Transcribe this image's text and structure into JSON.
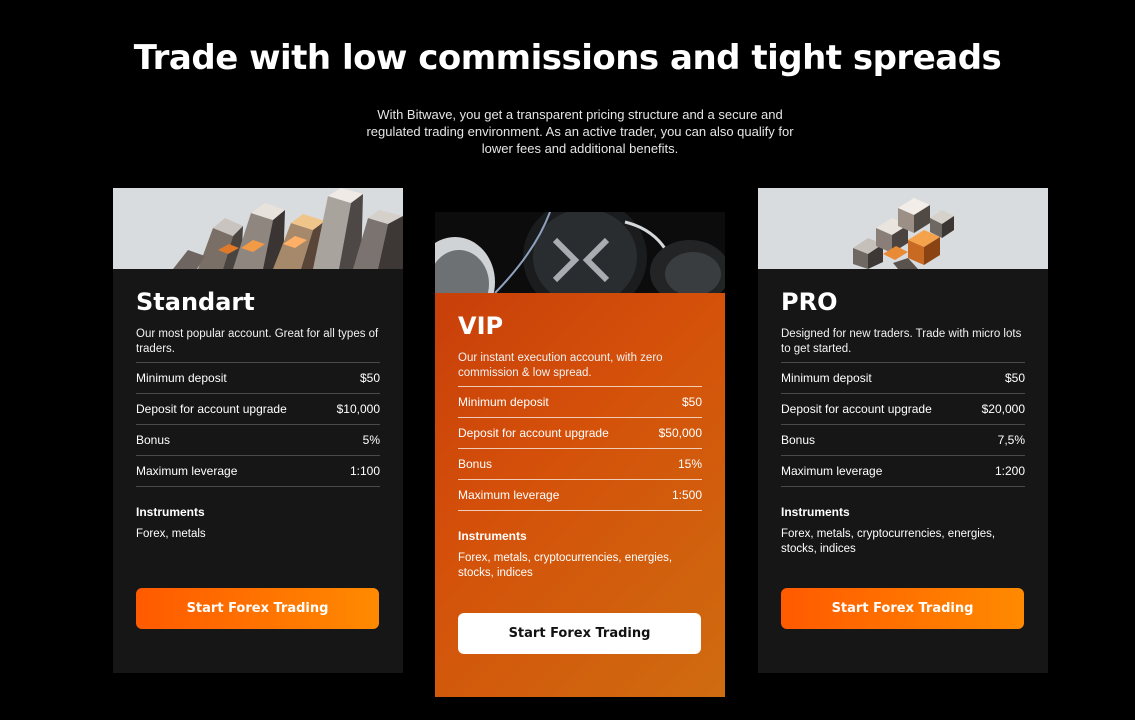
{
  "hero": {
    "headline": "Trade with low commissions and tight spreads",
    "subtitle": "With Bitwave, you get a transparent pricing structure and a secure and regulated trading environment. As an active trader, you can also qualify for lower fees and additional benefits."
  },
  "colors": {
    "background": "#000000",
    "card": "#161616",
    "accent_orange": "#ff6a00",
    "vip_gradient_start": "#c43a0a",
    "vip_gradient_end": "#cf6c10"
  },
  "plans": [
    {
      "name": "Standart",
      "description": "Our most popular account. Great for all types of traders.",
      "specs": [
        {
          "label": "Minimum deposit",
          "value": "$50"
        },
        {
          "label": "Deposit for account upgrade",
          "value": "$10,000"
        },
        {
          "label": "Bonus",
          "value": "5%"
        },
        {
          "label": "Maximum leverage",
          "value": "1:100"
        }
      ],
      "instruments_label": "Instruments",
      "instruments": "Forex, metals",
      "cta": "Start Forex Trading"
    },
    {
      "name": "VIP",
      "description": "Our instant execution account, with zero commission & low spread.",
      "specs": [
        {
          "label": "Minimum deposit",
          "value": "$50"
        },
        {
          "label": "Deposit for account upgrade",
          "value": "$50,000"
        },
        {
          "label": "Bonus",
          "value": "15%"
        },
        {
          "label": "Maximum leverage",
          "value": "1:500"
        }
      ],
      "instruments_label": "Instruments",
      "instruments": "Forex, metals, cryptocurrencies, energies, stocks, indices",
      "cta": "Start Forex Trading"
    },
    {
      "name": "PRO",
      "description": "Designed for new traders. Trade with micro lots to get started.",
      "specs": [
        {
          "label": "Minimum deposit",
          "value": "$50"
        },
        {
          "label": "Deposit for account upgrade",
          "value": "$20,000"
        },
        {
          "label": "Bonus",
          "value": "7,5%"
        },
        {
          "label": "Maximum leverage",
          "value": "1:200"
        }
      ],
      "instruments_label": "Instruments",
      "instruments": "Forex, metals, cryptocurrencies, energies, stocks, indices",
      "cta": "Start Forex Trading"
    }
  ]
}
